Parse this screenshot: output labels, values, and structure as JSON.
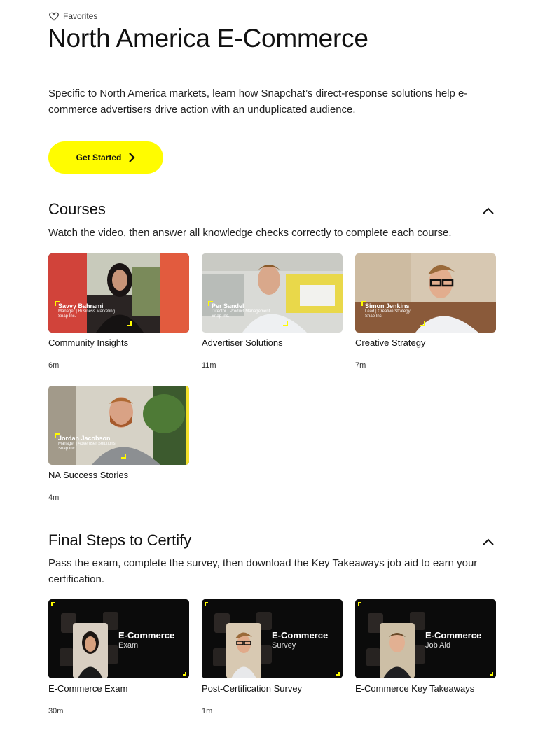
{
  "header": {
    "favorites_label": "Favorites",
    "title": "North America E-Commerce",
    "description": "Specific to North America markets, learn how Snapchat’s direct-response solutions help e-commerce advertisers drive action with an unduplicated audience.",
    "cta_label": "Get Started"
  },
  "courses": {
    "title": "Courses",
    "description": "Watch the video, then answer all knowledge checks correctly to complete each course.",
    "items": [
      {
        "title": "Community Insights",
        "duration": "6m",
        "presenter": "Savvy Bahrami",
        "role": "Manager | Business Marketing",
        "company": "Snap Inc."
      },
      {
        "title": "Advertiser Solutions",
        "duration": "11m",
        "presenter": "Per Sandel",
        "role": "Director | Product Management",
        "company": "Snap Inc."
      },
      {
        "title": "Creative Strategy",
        "duration": "7m",
        "presenter": "Simon Jenkins",
        "role": "Lead | Creative Strategy",
        "company": "Snap Inc."
      },
      {
        "title": "NA Success Stories",
        "duration": "4m",
        "presenter": "Jordan Jacobson",
        "role": "Manager | Advertiser Solutions",
        "company": "Snap Inc."
      }
    ]
  },
  "certify": {
    "title": "Final Steps to Certify",
    "description": "Pass the exam, complete the survey, then download the Key Takeaways job aid to earn your certification.",
    "items": [
      {
        "title": "E-Commerce Exam",
        "duration": "30m",
        "thumb_heading": "E-Commerce",
        "thumb_sub": "Exam"
      },
      {
        "title": "Post-Certification Survey",
        "duration": "1m",
        "thumb_heading": "E-Commerce",
        "thumb_sub": "Survey"
      },
      {
        "title": "E-Commerce Key Takeaways",
        "duration": "",
        "thumb_heading": "E-Commerce",
        "thumb_sub": "Job Aid"
      }
    ]
  },
  "colors": {
    "accent": "#fffc00",
    "text": "#111111"
  },
  "icons": {
    "favorites": "heart-icon",
    "cta": "chevron-right-icon",
    "collapse": "chevron-up-icon"
  }
}
